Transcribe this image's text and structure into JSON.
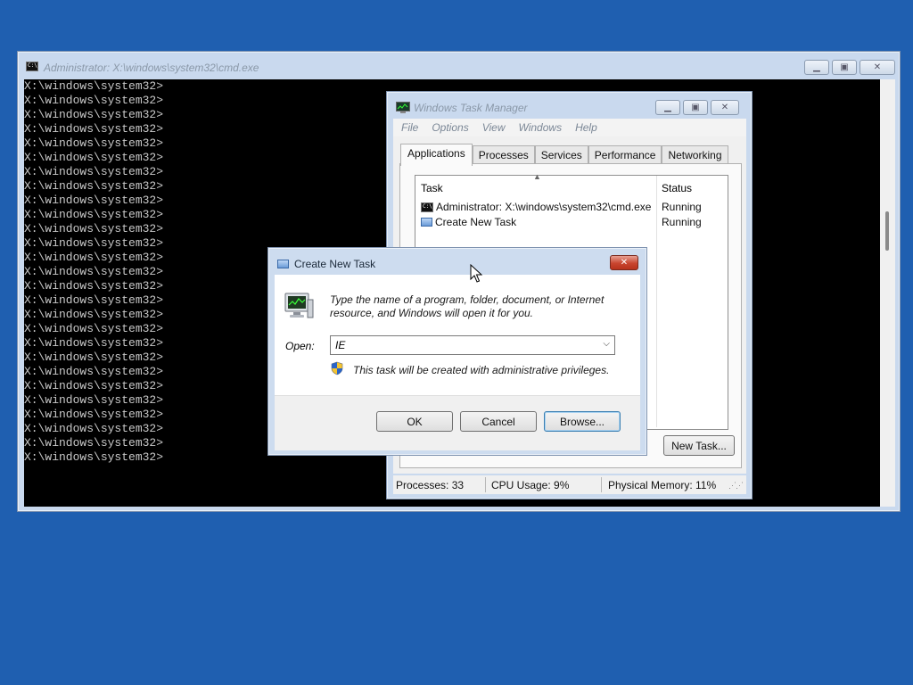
{
  "cmd": {
    "title": "Administrator: X:\\windows\\system32\\cmd.exe",
    "prompt": "X:\\windows\\system32>",
    "line_count": 27
  },
  "taskmgr": {
    "title": "Windows Task Manager",
    "menu": [
      "File",
      "Options",
      "View",
      "Windows",
      "Help"
    ],
    "tabs": [
      "Applications",
      "Processes",
      "Services",
      "Performance",
      "Networking"
    ],
    "selected_tab": "Applications",
    "columns": {
      "task": "Task",
      "status": "Status"
    },
    "rows": [
      {
        "task": "Administrator: X:\\windows\\system32\\cmd.exe",
        "status": "Running",
        "icon": "cmd-icon"
      },
      {
        "task": "Create New Task",
        "status": "Running",
        "icon": "app-window-icon"
      }
    ],
    "new_task_label": "New Task...",
    "status": {
      "processes": "Processes: 33",
      "cpu": "CPU Usage: 9%",
      "memory": "Physical Memory: 11%"
    }
  },
  "dialog": {
    "title": "Create New Task",
    "description": "Type the name of a program, folder, document, or Internet resource, and Windows will open it for you.",
    "open_label": "Open:",
    "open_value": "IE",
    "admin_note": "This task will be created with administrative privileges.",
    "ok_label": "OK",
    "cancel_label": "Cancel",
    "browse_label": "Browse..."
  },
  "colors": {
    "desktop": "#1f5fb0",
    "console_bg": "#000000",
    "console_text": "#c8c8c8",
    "close_button": "#c8452f"
  }
}
